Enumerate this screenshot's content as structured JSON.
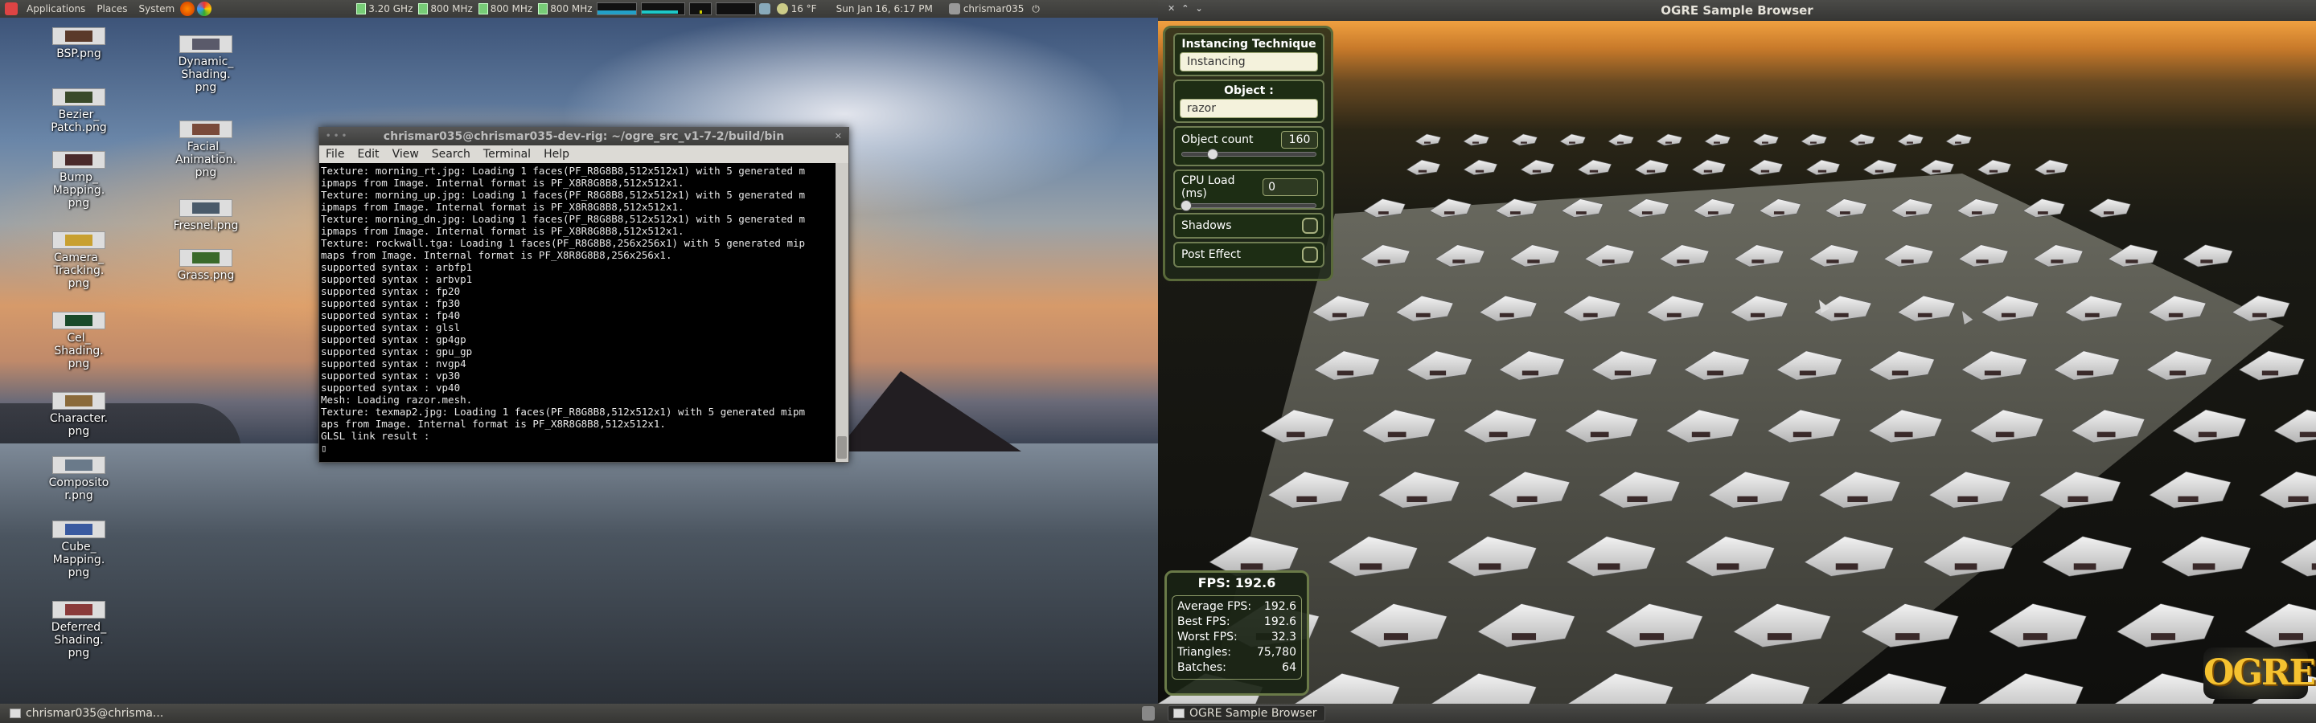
{
  "top_panel": {
    "menus": [
      "Applications",
      "Places",
      "System"
    ],
    "cpu_freqs": [
      "3.20 GHz",
      "800 MHz",
      "800 MHz",
      "800 MHz"
    ],
    "weather": "16 °F",
    "datetime": "Sun Jan 16,  6:17 PM",
    "user": "chrismar035",
    "power_glyph": "⏻"
  },
  "ogre_window": {
    "title": "OGRE Sample Browser"
  },
  "desktop_icons": [
    {
      "label": "BSP.png",
      "thumb_color": "#5a3a2a"
    },
    {
      "label": "Bezier_\nPatch.png",
      "thumb_color": "#3a4a2a"
    },
    {
      "label": "Bump_\nMapping.\npng",
      "thumb_color": "#4a2a2a"
    },
    {
      "label": "Camera_\nTracking.\npng",
      "thumb_color": "#c8a030"
    },
    {
      "label": "Cel_\nShading.\npng",
      "thumb_color": "#1a4a2a"
    },
    {
      "label": "Character.\npng",
      "thumb_color": "#8a6a3a"
    },
    {
      "label": "Composito\nr.png",
      "thumb_color": "#6a7a8a"
    },
    {
      "label": "Cube_\nMapping.\npng",
      "thumb_color": "#3a5aa0"
    },
    {
      "label": "Deferred_\nShading.\npng",
      "thumb_color": "#8a3a3a"
    },
    {
      "label": "Dynamic_\nShading.\npng",
      "thumb_color": "#5a5a6a"
    },
    {
      "label": "Facial_\nAnimation.\npng",
      "thumb_color": "#7a4a3a"
    },
    {
      "label": "Fresnel.png",
      "thumb_color": "#4a5a6a"
    },
    {
      "label": "Grass.png",
      "thumb_color": "#3a6a2a"
    }
  ],
  "terminal": {
    "title": "chrismar035@chrismar035-dev-rig: ~/ogre_src_v1-7-2/build/bin",
    "menu": [
      "File",
      "Edit",
      "View",
      "Search",
      "Terminal",
      "Help"
    ],
    "lines": [
      "Texture: morning_rt.jpg: Loading 1 faces(PF_R8G8B8,512x512x1) with 5 generated m",
      "ipmaps from Image. Internal format is PF_X8R8G8B8,512x512x1.",
      "Texture: morning_up.jpg: Loading 1 faces(PF_R8G8B8,512x512x1) with 5 generated m",
      "ipmaps from Image. Internal format is PF_X8R8G8B8,512x512x1.",
      "Texture: morning_dn.jpg: Loading 1 faces(PF_R8G8B8,512x512x1) with 5 generated m",
      "ipmaps from Image. Internal format is PF_X8R8G8B8,512x512x1.",
      "Texture: rockwall.tga: Loading 1 faces(PF_R8G8B8,256x256x1) with 5 generated mip",
      "maps from Image. Internal format is PF_X8R8G8B8,256x256x1.",
      "supported syntax : arbfp1",
      "supported syntax : arbvp1",
      "supported syntax : fp20",
      "supported syntax : fp30",
      "supported syntax : fp40",
      "supported syntax : glsl",
      "supported syntax : gp4gp",
      "supported syntax : gpu_gp",
      "supported syntax : nvgp4",
      "supported syntax : vp30",
      "supported syntax : vp40",
      "Mesh: Loading razor.mesh.",
      "Texture: texmap2.jpg: Loading 1 faces(PF_R8G8B8,512x512x1) with 5 generated mipm",
      "aps from Image. Internal format is PF_X8R8G8B8,512x512x1.",
      "GLSL link result :"
    ],
    "cursor": "▯"
  },
  "controls": {
    "technique_label": "Instancing Technique",
    "technique_value": "Instancing",
    "object_label": "Object :",
    "object_value": "razor",
    "object_count_label": "Object count",
    "object_count_value": "160",
    "object_count_fraction": 0.04,
    "cpu_load_label": "CPU Load (ms)",
    "cpu_load_value": "0",
    "cpu_load_fraction": 0.0,
    "shadows_label": "Shadows",
    "post_effect_label": "Post Effect"
  },
  "stats": {
    "fps_label": "FPS: 192.6",
    "rows": [
      {
        "label": "Average FPS:",
        "value": "192.6"
      },
      {
        "label": "Best FPS:",
        "value": "192.6"
      },
      {
        "label": "Worst FPS:",
        "value": "32.3"
      },
      {
        "label": "Triangles:",
        "value": "75,780"
      },
      {
        "label": "Batches:",
        "value": "64"
      }
    ]
  },
  "logo_text": "OGRE",
  "taskbar": {
    "left_task": "chrismar035@chrisma...",
    "right_task": "OGRE Sample Browser"
  },
  "colors": {
    "panel": "#3f3f3d",
    "widget_border": "#6f7d52",
    "logo": "#f5c230"
  }
}
